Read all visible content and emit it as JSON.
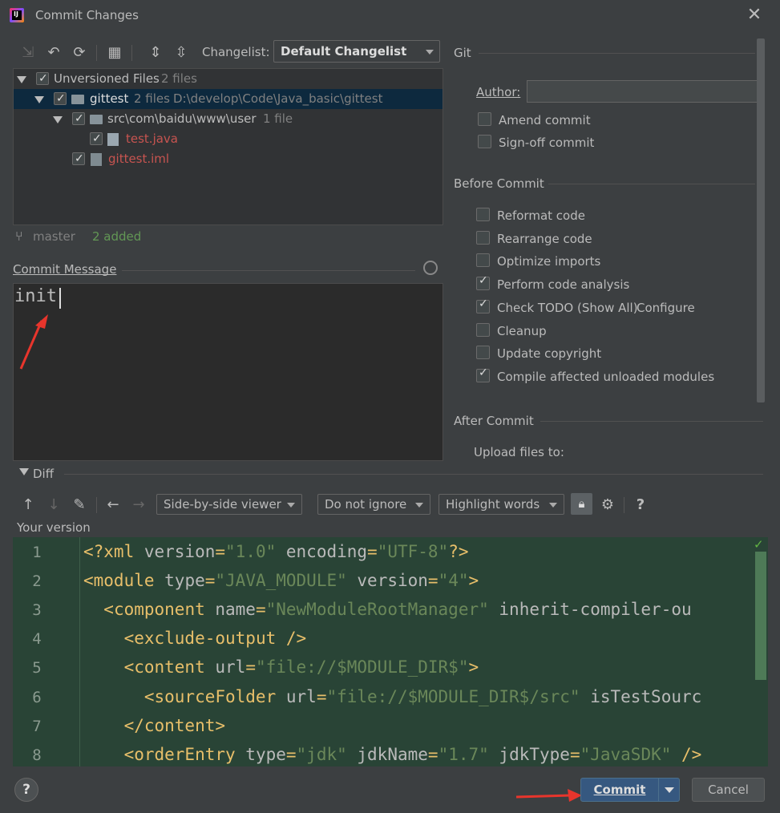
{
  "window": {
    "title": "Commit Changes",
    "close_icon": "close-icon"
  },
  "toolbar": {
    "changelist_label": "Changelist:",
    "changelist_value": "Default Changelist"
  },
  "tree": {
    "root": {
      "label": "Unversioned Files",
      "count": "2 files"
    },
    "module": {
      "label": "gittest",
      "count": "2 files",
      "path": "D:\\develop\\Code\\Java_basic\\gittest"
    },
    "folder": {
      "label": "src\\com\\baidu\\www\\user",
      "count": "1 file"
    },
    "file1": {
      "label": "test.java"
    },
    "file2": {
      "label": "gittest.iml"
    }
  },
  "status": {
    "branch": "master",
    "added": "2 added"
  },
  "commit_message": {
    "label": "Commit Message",
    "value": "init"
  },
  "git": {
    "section": "Git",
    "author_label": "Author:",
    "author_value": "",
    "amend": "Amend commit",
    "signoff": "Sign-off commit"
  },
  "before_commit": {
    "section": "Before Commit",
    "options": [
      {
        "label": "Reformat code",
        "checked": false
      },
      {
        "label": "Rearrange code",
        "checked": false
      },
      {
        "label": "Optimize imports",
        "checked": false
      },
      {
        "label": "Perform code analysis",
        "checked": true
      },
      {
        "label": "Check TODO (Show All)",
        "checked": true
      },
      {
        "label": "Cleanup",
        "checked": false
      },
      {
        "label": "Update copyright",
        "checked": false
      },
      {
        "label": "Compile affected unloaded modules",
        "checked": true
      }
    ],
    "configure_link": "Configure"
  },
  "after_commit": {
    "section": "After Commit",
    "upload_label": "Upload files to:"
  },
  "diff": {
    "section": "Diff",
    "viewer": "Side-by-side viewer",
    "ignore": "Do not ignore",
    "highlight": "Highlight words",
    "your_version": "Your version",
    "lines": [
      {
        "n": "1"
      },
      {
        "n": "2"
      },
      {
        "n": "3"
      },
      {
        "n": "4"
      },
      {
        "n": "5"
      },
      {
        "n": "6"
      },
      {
        "n": "7"
      },
      {
        "n": "8"
      }
    ]
  },
  "buttons": {
    "help": "?",
    "commit": "Commit",
    "cancel": "Cancel"
  },
  "colors": {
    "accent": "#365880",
    "editor_bg": "#294436",
    "link": "#589df6",
    "added": "#629755",
    "unversioned": "#c75450"
  }
}
